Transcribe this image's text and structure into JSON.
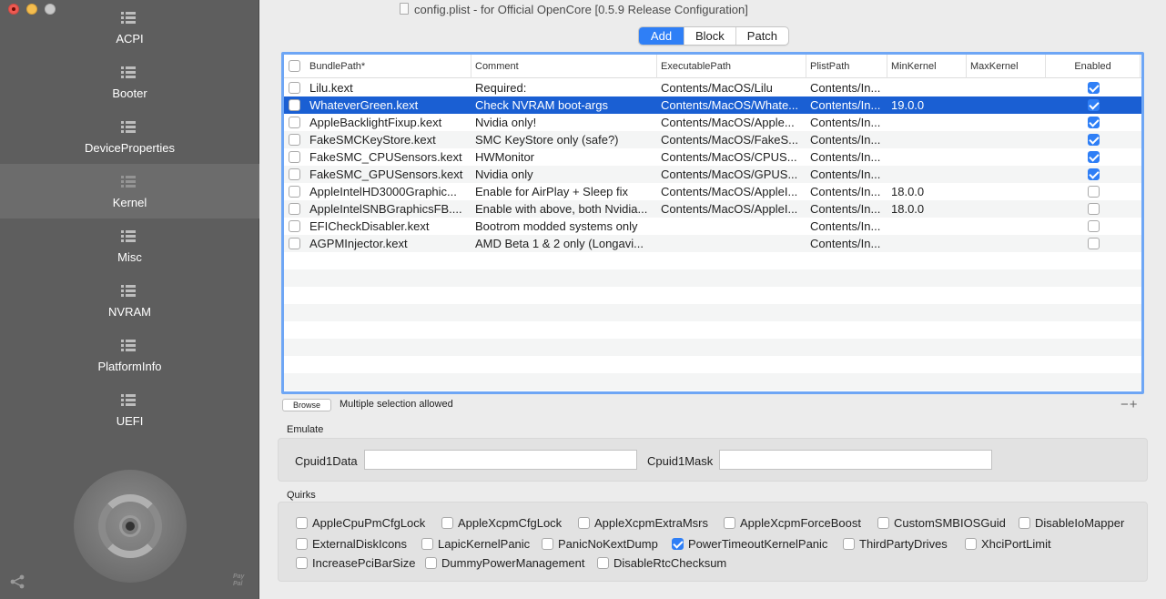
{
  "window": {
    "title": "config.plist - for Official OpenCore [0.5.9 Release Configuration]"
  },
  "sidebar": {
    "items": [
      {
        "label": "ACPI",
        "icon": "grid-icon",
        "active": false
      },
      {
        "label": "Booter",
        "icon": "grid-icon",
        "active": false
      },
      {
        "label": "DeviceProperties",
        "icon": "grid-icon",
        "active": false
      },
      {
        "label": "Kernel",
        "icon": "grid-icon",
        "active": true
      },
      {
        "label": "Misc",
        "icon": "grid-icon",
        "active": false
      },
      {
        "label": "NVRAM",
        "icon": "grid-icon",
        "active": false
      },
      {
        "label": "PlatformInfo",
        "icon": "grid-icon",
        "active": false
      },
      {
        "label": "UEFI",
        "icon": "grid-icon",
        "active": false
      }
    ],
    "paypal": "Pay\nPal"
  },
  "tabs": [
    {
      "label": "Add",
      "active": true
    },
    {
      "label": "Block",
      "active": false
    },
    {
      "label": "Patch",
      "active": false
    }
  ],
  "table": {
    "columns": [
      "BundlePath*",
      "Comment",
      "ExecutablePath",
      "PlistPath",
      "MinKernel",
      "MaxKernel",
      "Enabled"
    ],
    "rows": [
      {
        "bundle": "Lilu.kext",
        "comment": "Required:",
        "exec": "Contents/MacOS/Lilu",
        "plist": "Contents/In...",
        "min": "",
        "max": "",
        "enabled": true,
        "selected": false
      },
      {
        "bundle": "WhateverGreen.kext",
        "comment": "Check NVRAM boot-args",
        "exec": "Contents/MacOS/Whate...",
        "plist": "Contents/In...",
        "min": "19.0.0",
        "max": "",
        "enabled": true,
        "selected": true
      },
      {
        "bundle": "AppleBacklightFixup.kext",
        "comment": "Nvidia only!",
        "exec": "Contents/MacOS/Apple...",
        "plist": "Contents/In...",
        "min": "",
        "max": "",
        "enabled": true,
        "selected": false
      },
      {
        "bundle": "FakeSMCKeyStore.kext",
        "comment": "SMC KeyStore only (safe?)",
        "exec": "Contents/MacOS/FakeS...",
        "plist": "Contents/In...",
        "min": "",
        "max": "",
        "enabled": true,
        "selected": false
      },
      {
        "bundle": "FakeSMC_CPUSensors.kext",
        "comment": "HWMonitor",
        "exec": "Contents/MacOS/CPUS...",
        "plist": "Contents/In...",
        "min": "",
        "max": "",
        "enabled": true,
        "selected": false
      },
      {
        "bundle": "FakeSMC_GPUSensors.kext",
        "comment": "Nvidia only",
        "exec": "Contents/MacOS/GPUS...",
        "plist": "Contents/In...",
        "min": "",
        "max": "",
        "enabled": true,
        "selected": false
      },
      {
        "bundle": "AppleIntelHD3000Graphic...",
        "comment": "Enable for AirPlay + Sleep fix",
        "exec": "Contents/MacOS/AppleI...",
        "plist": "Contents/In...",
        "min": "18.0.0",
        "max": "",
        "enabled": false,
        "selected": false
      },
      {
        "bundle": "AppleIntelSNBGraphicsFB....",
        "comment": "Enable with above, both Nvidia...",
        "exec": "Contents/MacOS/AppleI...",
        "plist": "Contents/In...",
        "min": "18.0.0",
        "max": "",
        "enabled": false,
        "selected": false
      },
      {
        "bundle": "EFICheckDisabler.kext",
        "comment": "Bootrom modded systems only",
        "exec": "",
        "plist": "Contents/In...",
        "min": "",
        "max": "",
        "enabled": false,
        "selected": false
      },
      {
        "bundle": "AGPMInjector.kext",
        "comment": "AMD Beta 1 & 2 only (Longavi...",
        "exec": "",
        "plist": "Contents/In...",
        "min": "",
        "max": "",
        "enabled": false,
        "selected": false
      }
    ]
  },
  "below_table": {
    "browse_label": "Browse",
    "multi_text": "Multiple selection allowed",
    "plusminus": "−+"
  },
  "emulate": {
    "title": "Emulate",
    "cpuid1data_label": "Cpuid1Data",
    "cpuid1data_value": "",
    "cpuid1mask_label": "Cpuid1Mask",
    "cpuid1mask_value": ""
  },
  "quirks": {
    "title": "Quirks",
    "items": [
      {
        "label": "AppleCpuPmCfgLock",
        "checked": false
      },
      {
        "label": "AppleXcpmCfgLock",
        "checked": false
      },
      {
        "label": "AppleXcpmExtraMsrs",
        "checked": false
      },
      {
        "label": "AppleXcpmForceBoost",
        "checked": false
      },
      {
        "label": "CustomSMBIOSGuid",
        "checked": false
      },
      {
        "label": "DisableIoMapper",
        "checked": false
      },
      {
        "label": "ExternalDiskIcons",
        "checked": false
      },
      {
        "label": "LapicKernelPanic",
        "checked": false
      },
      {
        "label": "PanicNoKextDump",
        "checked": false
      },
      {
        "label": "PowerTimeoutKernelPanic",
        "checked": true
      },
      {
        "label": "ThirdPartyDrives",
        "checked": false
      },
      {
        "label": "XhciPortLimit",
        "checked": false
      },
      {
        "label": "IncreasePciBarSize",
        "checked": false
      },
      {
        "label": "DummyPowerManagement",
        "checked": false
      },
      {
        "label": "DisableRtcChecksum",
        "checked": false
      }
    ]
  },
  "colors": {
    "accent": "#2f7ff6",
    "selection": "#1a5fd3",
    "sidebar": "#5e5e5e",
    "sidebar_active": "#6c6c6c"
  }
}
